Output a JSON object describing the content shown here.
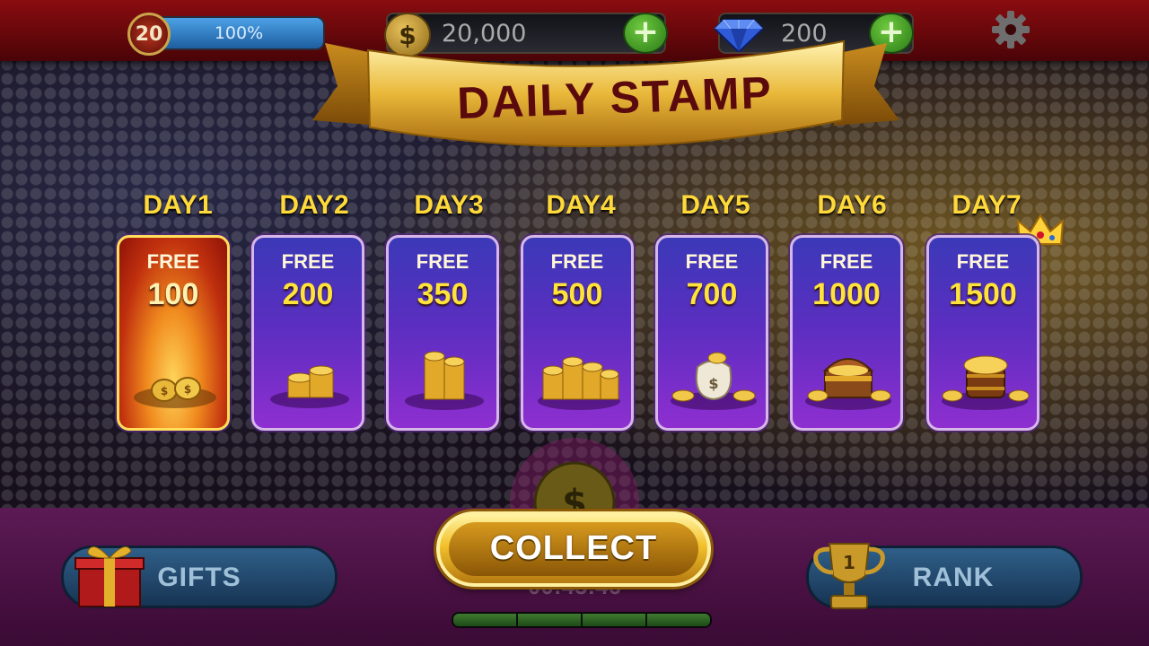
{
  "header": {
    "level": "20",
    "xp_percent_label": "100%",
    "xp_progress": 1.0,
    "coins": "20,000",
    "gems": "200"
  },
  "banner": {
    "title": "DAILY STAMP"
  },
  "days": [
    {
      "label": "DAY1",
      "free_label": "FREE",
      "amount": "100",
      "state": "active",
      "reward_icon": "coin-pile-icon"
    },
    {
      "label": "DAY2",
      "free_label": "FREE",
      "amount": "200",
      "state": "locked",
      "reward_icon": "coin-stacks-icon"
    },
    {
      "label": "DAY3",
      "free_label": "FREE",
      "amount": "350",
      "state": "locked",
      "reward_icon": "coin-tower-icon"
    },
    {
      "label": "DAY4",
      "free_label": "FREE",
      "amount": "500",
      "state": "locked",
      "reward_icon": "coin-stacks-icon"
    },
    {
      "label": "DAY5",
      "free_label": "FREE",
      "amount": "700",
      "state": "locked",
      "reward_icon": "money-bag-icon"
    },
    {
      "label": "DAY6",
      "free_label": "FREE",
      "amount": "1000",
      "state": "locked",
      "reward_icon": "treasure-chest-icon"
    },
    {
      "label": "DAY7",
      "free_label": "FREE",
      "amount": "1500",
      "state": "locked",
      "reward_icon": "treasure-barrel-icon"
    }
  ],
  "bottom": {
    "gifts_label": "GIFTS",
    "collect_label": "COLLECT",
    "timer": "00:45:46",
    "rank_label": "RANK",
    "trophy_number": "1",
    "timer_progress_segments": 4
  },
  "colors": {
    "accent_gold": "#ffd93a",
    "banner_text": "#5a0a0c",
    "active_card": "#f08a1e",
    "card_purple": "#5a2ec0",
    "topbar_red": "#8a0c10"
  }
}
